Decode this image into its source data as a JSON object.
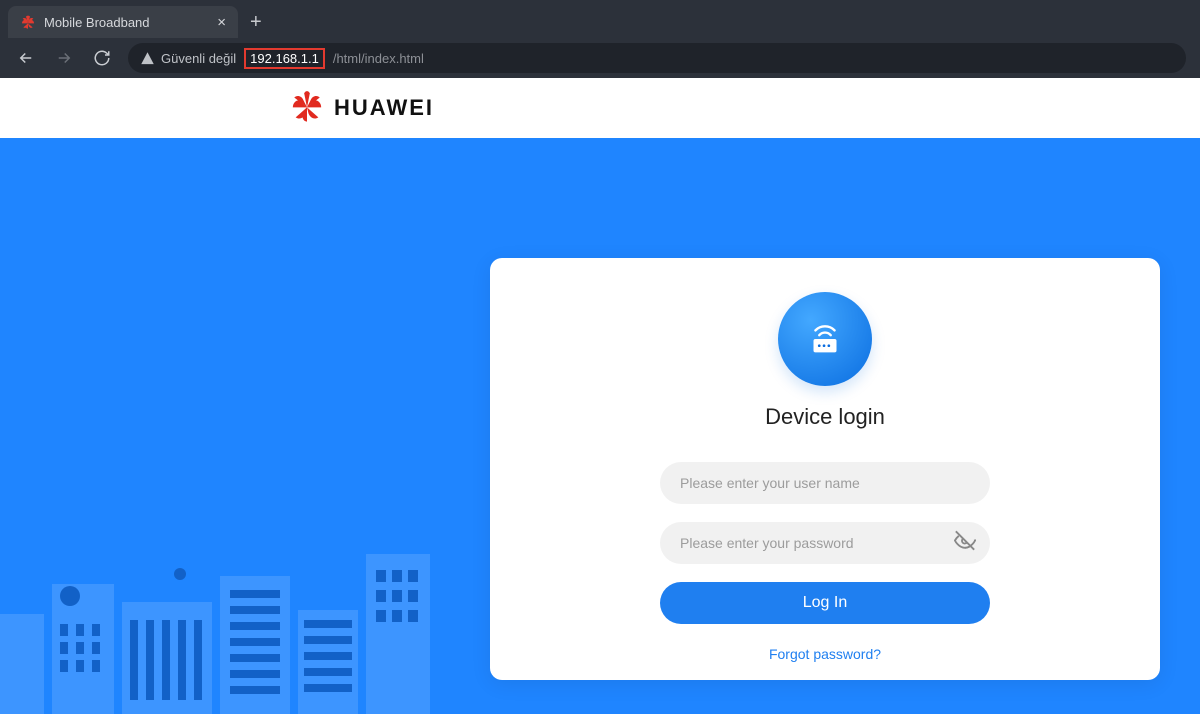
{
  "browser": {
    "tab_title": "Mobile Broadband",
    "security_label": "Güvenli değil",
    "url_highlight": "192.168.1.1",
    "url_rest": "/html/index.html"
  },
  "brand": {
    "name": "HUAWEI"
  },
  "login": {
    "title": "Device login",
    "username_placeholder": "Please enter your user name",
    "password_placeholder": "Please enter your password",
    "button_label": "Log In",
    "forgot_label": "Forgot password?"
  },
  "colors": {
    "hero_bg": "#1f85ff",
    "primary_btn": "#1f7ff0",
    "brand_red": "#e12a1f"
  }
}
